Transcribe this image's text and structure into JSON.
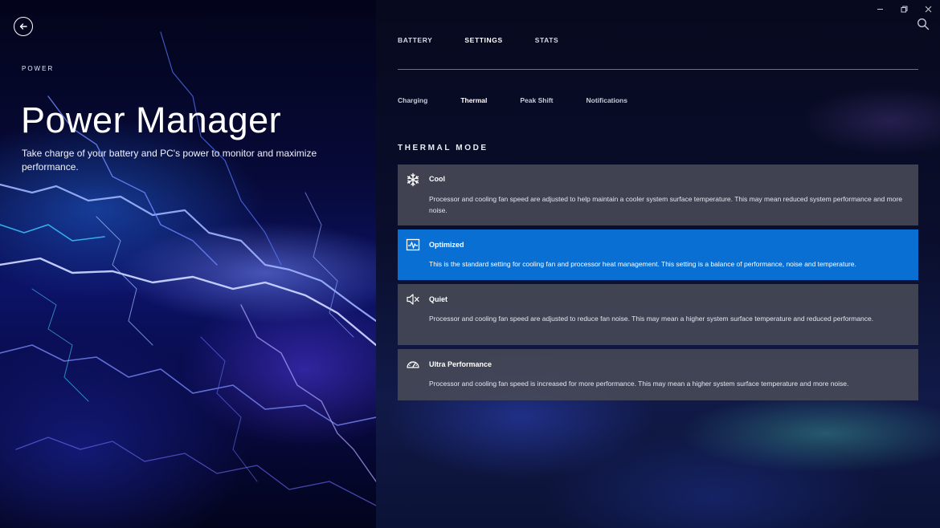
{
  "hero": {
    "kicker": "POWER",
    "title": "Power Manager",
    "subtitle": "Take charge of your battery and PC's power to monitor and maximize performance."
  },
  "nav": {
    "back_icon": "back-arrow-icon",
    "tabs": [
      {
        "label": "BATTERY",
        "active": false
      },
      {
        "label": "SETTINGS",
        "active": true
      },
      {
        "label": "STATS",
        "active": false
      }
    ],
    "subtabs": [
      {
        "label": "Charging",
        "active": false
      },
      {
        "label": "Thermal",
        "active": true
      },
      {
        "label": "Peak Shift",
        "active": false
      },
      {
        "label": "Notifications",
        "active": false
      }
    ]
  },
  "window": {
    "controls": [
      "minimize-icon",
      "restore-icon",
      "close-icon"
    ],
    "search_icon": "search-icon"
  },
  "thermal": {
    "heading": "THERMAL MODE",
    "selected": "Optimized",
    "modes": [
      {
        "icon": "snowflake-icon",
        "title": "Cool",
        "description": "Processor and cooling fan speed are adjusted to help maintain a cooler system surface temperature. This may mean reduced system performance and more noise."
      },
      {
        "icon": "pulse-graph-icon",
        "title": "Optimized",
        "description": "This is the standard setting for cooling fan and processor heat management. This setting is a balance of performance, noise and temperature."
      },
      {
        "icon": "speaker-mute-icon",
        "title": "Quiet",
        "description": "Processor and cooling fan speed are adjusted to reduce fan noise. This may mean a higher system surface temperature and reduced performance."
      },
      {
        "icon": "speedometer-icon",
        "title": "Ultra Performance",
        "description": "Processor and cooling fan speed is increased for more performance. This may mean a higher system surface temperature and more noise."
      }
    ]
  },
  "colors": {
    "selected_mode": "#0a6fd2",
    "card_background": "#484a56"
  }
}
